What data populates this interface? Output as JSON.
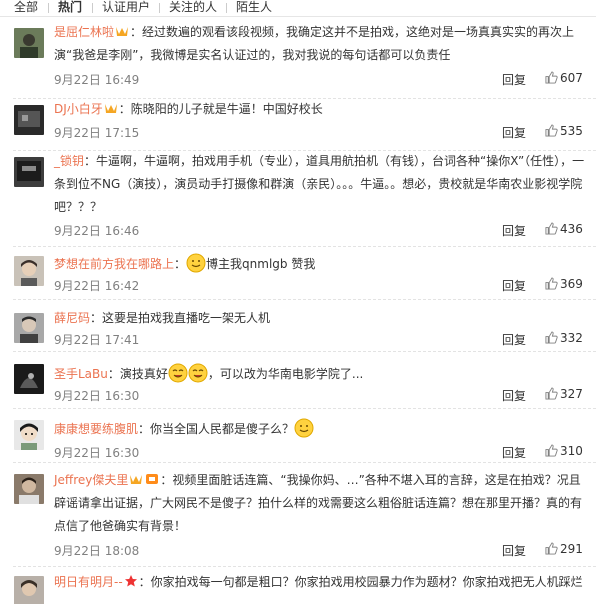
{
  "tabs": [
    {
      "label": "全部"
    },
    {
      "label": "热门"
    },
    {
      "label": "认证用户"
    },
    {
      "label": "关注的人"
    },
    {
      "label": "陌生人"
    }
  ],
  "colors": {
    "username": "#eb7350",
    "time": "#808080",
    "text": "#333333"
  },
  "comments": [
    {
      "user": "是屈仁林啦",
      "badge": "vip-crown-icon",
      "body": "：经过数遍的观看该段视频，我确定这并不是拍戏，这绝对是一场真真实实的再次上演“我爸是李刚”，我微博是实名认证过的，我对我说的每句话都可以负责任",
      "time": "9月22日 16:49",
      "reply": "回复",
      "likes": "607"
    },
    {
      "user": "DJ小白牙",
      "badge": "vip-crown-icon",
      "body": "：陈晓阳的儿子就是牛逼！中国好校长",
      "time": "9月22日 17:15",
      "reply": "回复",
      "likes": "535"
    },
    {
      "user": "_锁钥",
      "body": "：牛逼啊，牛逼啊，拍戏用手机（专业），道具用航拍机（有钱），台词各种“操你X”（任性），一条到位不NG（演技），演员动手打摄像和群演（亲民）。。。牛逼。。想必，贵校就是华南农业影视学院吧？？？",
      "time": "9月22日 16:46",
      "reply": "回复",
      "likes": "436"
    },
    {
      "user": "梦想在前方我在哪路上",
      "body_pre": "：",
      "body": "博主我qnmlgb 赞我",
      "time": "9月22日 16:42",
      "reply": "回复",
      "likes": "369"
    },
    {
      "user": "薛尼码",
      "body": "：这要是拍戏我直播吃一架无人机",
      "time": "9月22日 17:41",
      "reply": "回复",
      "likes": "332"
    },
    {
      "user": "圣手LaBu",
      "body_pre": "：演技真好",
      "body": "，可以改为华南电影学院了...",
      "time": "9月22日 16:30",
      "reply": "回复",
      "likes": "327"
    },
    {
      "user": "康康想要练腹肌",
      "body": "：你当全国人民都是傻子么？",
      "time": "9月22日 16:30",
      "reply": "回复",
      "likes": "310"
    },
    {
      "user": "Jeffrey傑夫里",
      "badge": "vip-crown-icon",
      "body": "：视频里面脏话连篇、“我操你妈、…”各种不堪入耳的言辞，这是在拍戏？况且辟谣请拿出证据，广大网民不是傻子？拍什么样的戏需要这么粗俗脏话连篇？想在那里开播？真的有点信了他爸确实有背景！",
      "time": "9月22日 18:08",
      "reply": "回复",
      "likes": "291"
    },
    {
      "user": "明日有明月--",
      "badge": "star-icon",
      "body": "：你家拍戏每一句都是粗口？你家拍戏用校园暴力作为题材？你家拍戏把无人机踩烂"
    }
  ]
}
